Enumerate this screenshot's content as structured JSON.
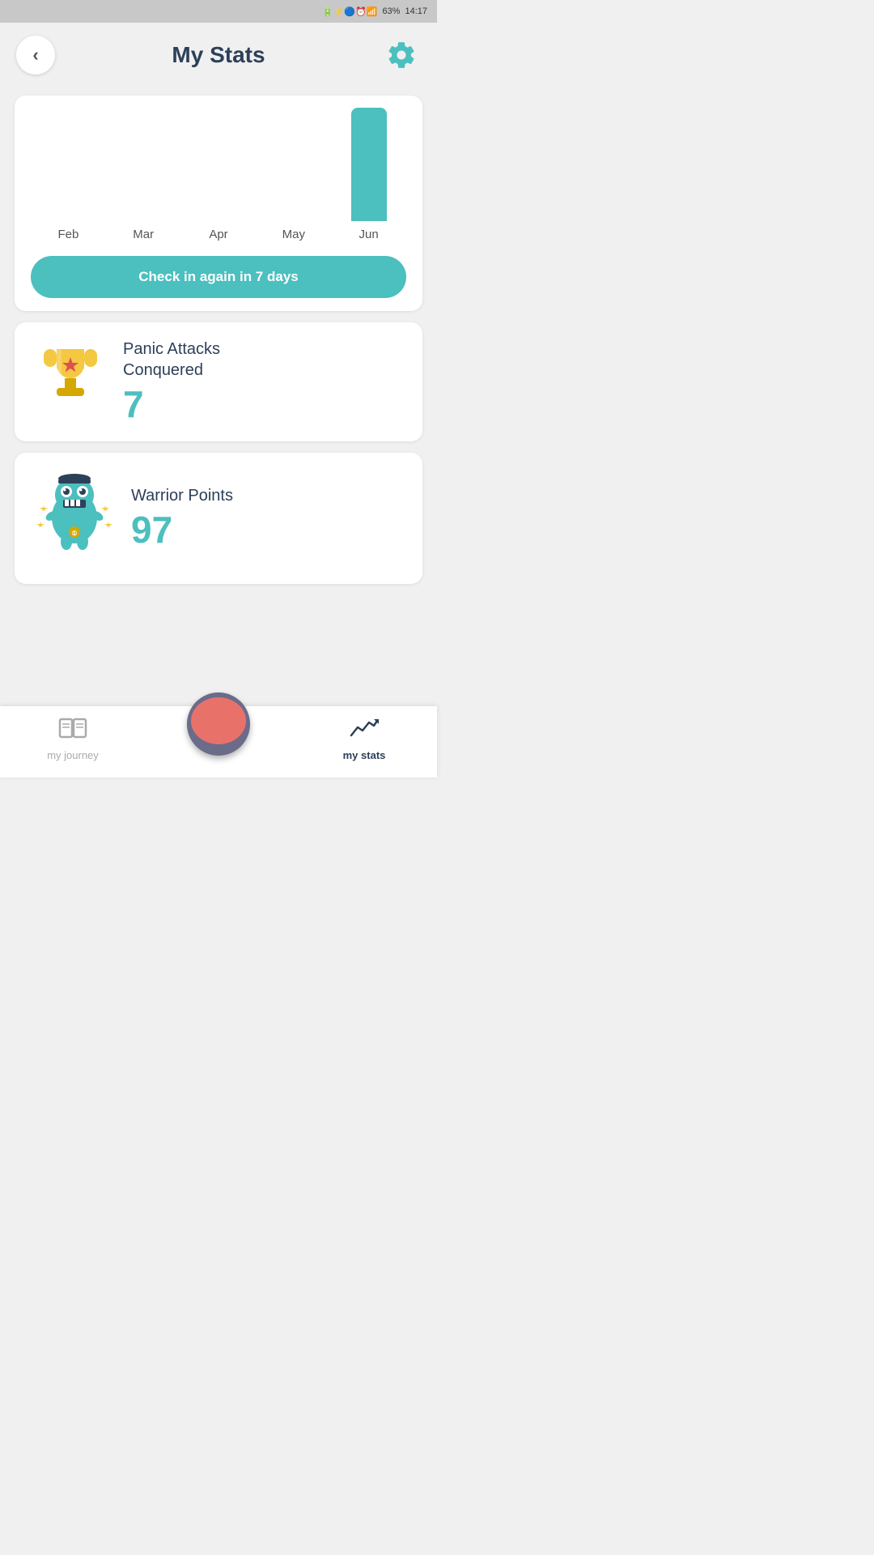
{
  "status_bar": {
    "battery_pct": "63%",
    "time": "14:17",
    "icons": "battery bluetooth alarm signal"
  },
  "header": {
    "back_label": "‹",
    "title": "My Stats",
    "settings_icon": "gear"
  },
  "chart": {
    "months": [
      "Feb",
      "Mar",
      "Apr",
      "May",
      "Jun"
    ],
    "bar_heights": [
      0,
      0,
      0,
      0,
      140
    ],
    "active_month_index": 4,
    "check_in_label": "Check in again in 7 days"
  },
  "panic_card": {
    "label_line1": "Panic Attacks",
    "label_line2": "Conquered",
    "value": "7"
  },
  "warrior_card": {
    "label": "Warrior Points",
    "value": "97"
  },
  "bottom_nav": {
    "items": [
      {
        "id": "my-journey",
        "label": "my journey",
        "active": false,
        "icon": "book"
      },
      {
        "id": "panic-button",
        "label": "",
        "active": false,
        "icon": "panic"
      },
      {
        "id": "my-stats",
        "label": "my stats",
        "active": true,
        "icon": "stats"
      }
    ]
  }
}
